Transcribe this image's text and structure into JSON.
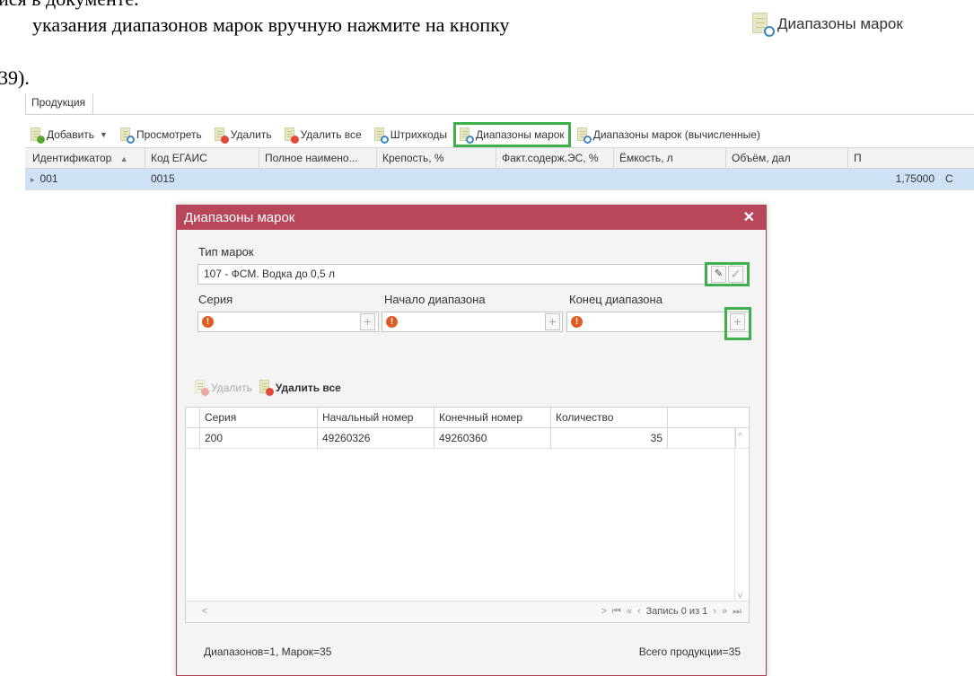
{
  "document": {
    "line1": "ися в документе.",
    "line2": "указания диапазонов марок вручную нажмите на кнопку",
    "line3": "39).",
    "inline_button_label": "Диапазоны марок"
  },
  "app": {
    "tab_label": "Продукция",
    "toolbar": {
      "add": "Добавить",
      "view": "Просмотреть",
      "delete": "Удалить",
      "delete_all": "Удалить все",
      "barcodes": "Штрихкоды",
      "stamp_ranges": "Диапазоны марок",
      "stamp_ranges_calc": "Диапазоны марок (вычисленные)"
    },
    "grid": {
      "headers": [
        "Идентификатор",
        "Код ЕГАИС",
        "Полное наимено...",
        "Крепость, %",
        "Факт.содерж.ЭС, %",
        "Ёмкость, л",
        "Объём, дал",
        "П"
      ],
      "sort_indicator": "▲",
      "row": {
        "id": "001",
        "egais": "0015",
        "volume": "1,75000",
        "extra": "С"
      }
    }
  },
  "dialog": {
    "title": "Диапазоны марок",
    "close": "✕",
    "stamp_type_label": "Тип марок",
    "stamp_type_value": "107 - ФСМ. Водка до 0,5 л",
    "series_label": "Серия",
    "range_start_label": "Начало диапазона",
    "range_end_label": "Конец диапазона",
    "delete_label": "Удалить",
    "delete_all_label": "Удалить все",
    "table": {
      "headers": [
        "Серия",
        "Начальный номер",
        "Конечный номер",
        "Количество"
      ],
      "rows": [
        {
          "series": "200",
          "start": "49260326",
          "end": "49260360",
          "count": "35"
        }
      ]
    },
    "pager_text": "Запись 0 из 1",
    "status_left": "Диапазонов=1, Марок=35",
    "status_right": "Всего продукции=35"
  },
  "colors": {
    "dialog_header": "#b9475c",
    "highlight": "#3db04c",
    "selected_row": "#cfe1f4"
  }
}
